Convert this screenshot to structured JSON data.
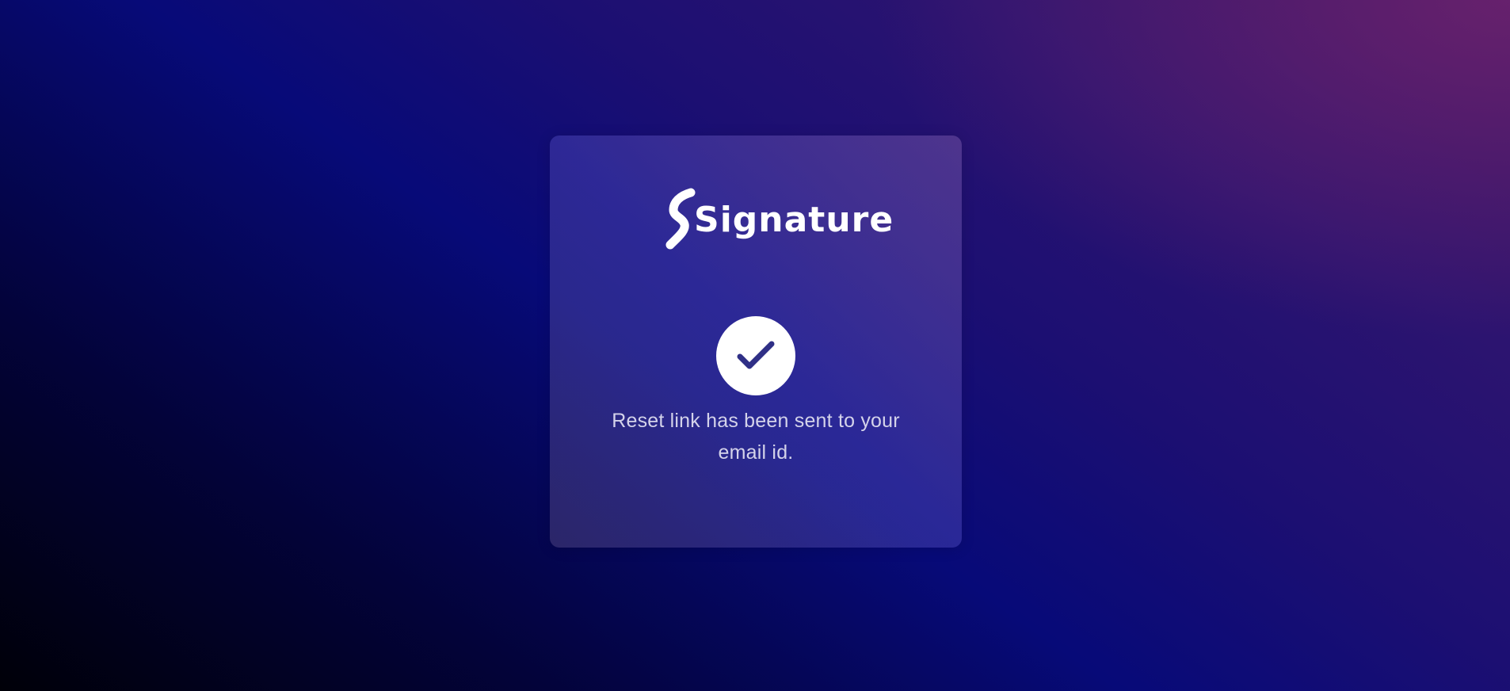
{
  "brand": {
    "name": "Signature"
  },
  "status": {
    "icon": "check-circle-icon",
    "message": "Reset link has been sent to your email id."
  },
  "colors": {
    "icon_check": "#2f2f86",
    "message_text": "#d4d3ea",
    "background_dark": "#000008",
    "background_blue": "#070a78",
    "background_purple": "#6e236e"
  }
}
